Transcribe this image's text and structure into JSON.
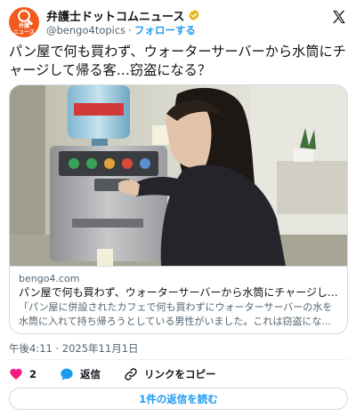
{
  "account": {
    "display_name": "弁護士ドットコムニュース",
    "handle": "@bengo4topics",
    "separator": "·",
    "follow_label": "フォローする",
    "avatar_text": "弁護\nニュース",
    "brand_color": "#f35a1d"
  },
  "tweet": {
    "text": "パン屋で何も買わず、ウォーターサーバーから水筒にチャージして帰る客…窃盗になる？"
  },
  "link_card": {
    "domain": "bengo4.com",
    "title": "パン屋で何も買わず、ウォーターサーバーから水筒にチャージして帰る...",
    "description": "「パン屋に併設されたカフェで何も買わずにウォーターサーバーの水を水筒に入れて持ち帰ろうとしている男性がいました。これは窃盗にな..."
  },
  "meta": {
    "timestamp": "午後4:11 · 2025年11月1日"
  },
  "actions": {
    "like_count": "2",
    "reply_label": "返信",
    "copy_link_label": "リンクをコピー",
    "read_replies_label": "1件の返信を読む"
  },
  "colors": {
    "accent": "#1d9bf0",
    "like": "#f91880",
    "verified": "#e2b719",
    "secondary_text": "#536471"
  }
}
